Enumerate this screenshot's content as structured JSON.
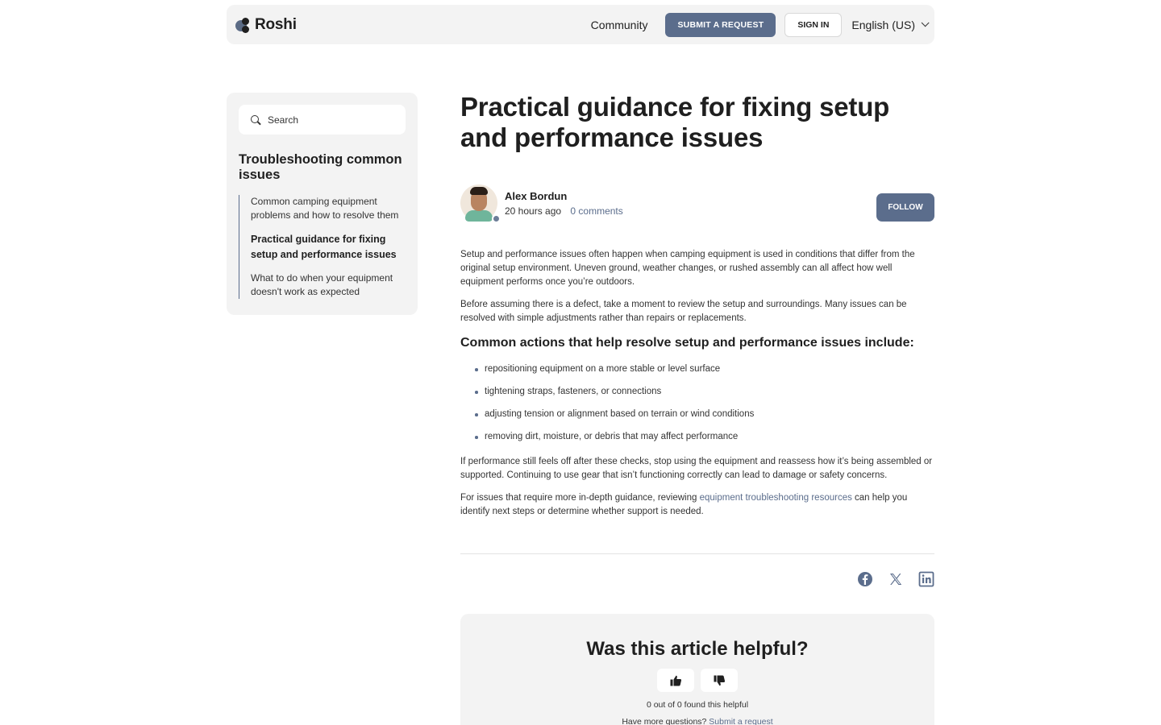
{
  "header": {
    "logo_text": "Roshi",
    "nav_community": "Community",
    "submit_label": "SUBMIT A REQUEST",
    "signin_label": "SIGN IN",
    "language": "English (US)"
  },
  "sidebar": {
    "search_placeholder": "Search",
    "section_title": "Troubleshooting common issues",
    "items": [
      {
        "label": "Common camping equipment problems and how to resolve them",
        "active": false
      },
      {
        "label": "Practical guidance for fixing setup and performance issues",
        "active": true
      },
      {
        "label": "What to do when your equipment doesn't work as expected",
        "active": false
      }
    ]
  },
  "article": {
    "title": "Practical guidance for fixing setup and performance issues",
    "author": "Alex Bordun",
    "posted": "20 hours ago",
    "comments": "0 comments",
    "follow_label": "FOLLOW",
    "para1": "Setup and performance issues often happen when camping equipment is used in conditions that differ from the original setup environment. Uneven ground, weather changes, or rushed assembly can all affect how well equipment performs once you’re outdoors.",
    "para2": "Before assuming there is a defect, take a moment to review the setup and surroundings. Many issues can be resolved with simple adjustments rather than repairs or replacements.",
    "subheading": "Common actions that help resolve setup and performance issues include:",
    "bullets": [
      "repositioning equipment on a more stable or level surface",
      "tightening straps, fasteners, or connections",
      "adjusting tension or alignment based on terrain or wind conditions",
      "removing dirt, moisture, or debris that may affect performance"
    ],
    "para3": "If performance still feels off after these checks, stop using the equipment and reassess how it’s being assembled or supported. Continuing to use gear that isn’t functioning correctly can lead to damage or safety concerns.",
    "para4_before": "For issues that require more in-depth guidance, reviewing ",
    "para4_link": "equipment troubleshooting resources",
    "para4_after": " can help you identify next steps or determine whether support is needed."
  },
  "share": {
    "icons": [
      "facebook-icon",
      "x-icon",
      "linkedin-icon"
    ]
  },
  "feedback": {
    "title": "Was this article helpful?",
    "count_text": "0 out of 0 found this helpful",
    "more_text": "Have more questions? ",
    "more_link": "Submit a request"
  },
  "colors": {
    "accent": "#5b6d8c",
    "panel_bg": "#f3f3f3",
    "text": "#1f1f1f"
  }
}
